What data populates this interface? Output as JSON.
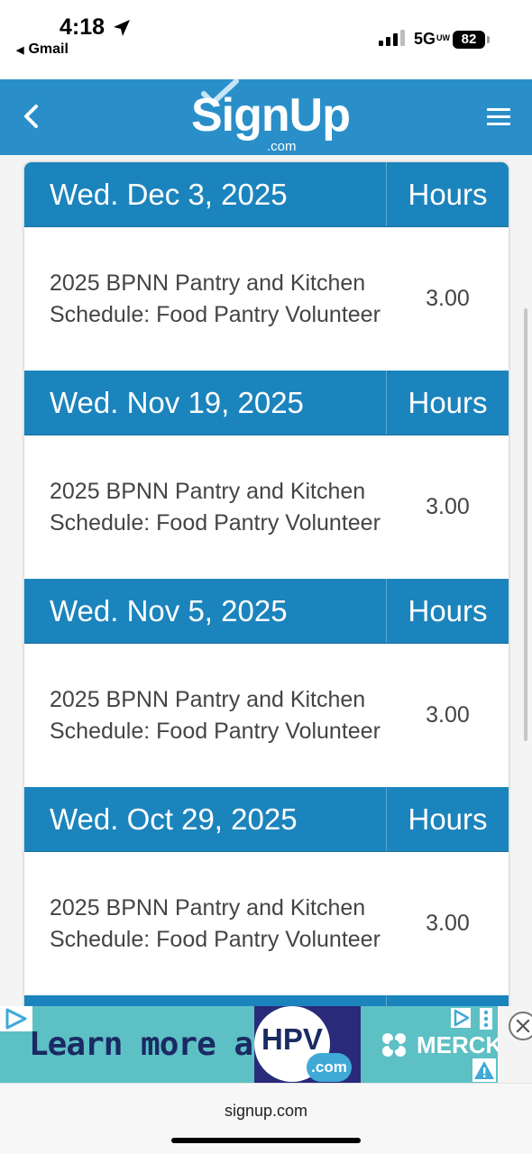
{
  "status_bar": {
    "time": "4:18",
    "back_app": "Gmail",
    "network": "5G",
    "network_suffix": "UW",
    "battery": "82"
  },
  "navbar": {
    "logo_main": "SignUp",
    "logo_domain": ".com"
  },
  "entries": [
    {
      "date": "Wed. Dec 3, 2025",
      "hours_header": "Hours",
      "title": "2025 BPNN Pantry and Kitchen Schedule: Food Pantry Volunteer",
      "hours": "3.00"
    },
    {
      "date": "Wed. Nov 19, 2025",
      "hours_header": "Hours",
      "title": "2025 BPNN Pantry and Kitchen Schedule: Food Pantry Volunteer",
      "hours": "3.00"
    },
    {
      "date": "Wed. Nov 5, 2025",
      "hours_header": "Hours",
      "title": "2025 BPNN Pantry and Kitchen Schedule: Food Pantry Volunteer",
      "hours": "3.00"
    },
    {
      "date": "Wed. Oct 29, 2025",
      "hours_header": "Hours",
      "title": "2025 BPNN Pantry and Kitchen Schedule: Food Pantry Volunteer",
      "hours": "3.00"
    }
  ],
  "ad": {
    "text": "Learn more at",
    "hpv": "HPV",
    "com": ".com",
    "brand": "MERCK"
  },
  "browser": {
    "url": "signup.com"
  },
  "colors": {
    "navbar": "#2a8fc9",
    "section_header": "#1b84bd",
    "ad_background": "#5dc0c4"
  }
}
